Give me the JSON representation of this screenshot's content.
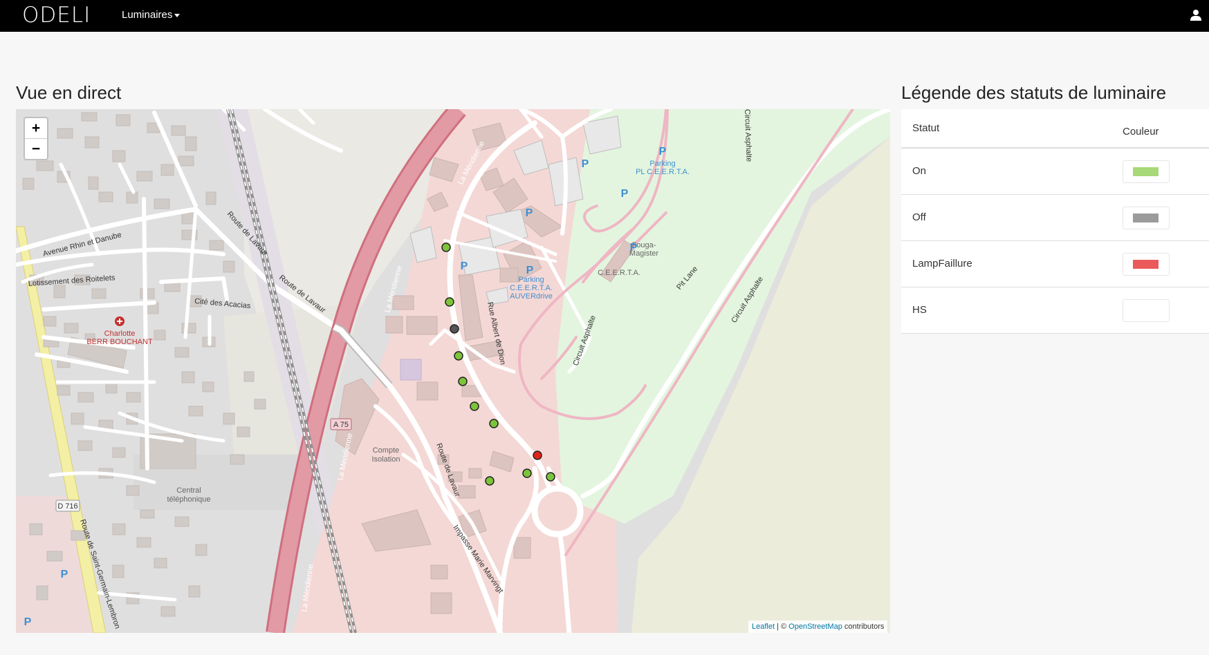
{
  "navbar": {
    "brand": "ODELI",
    "menu_label": "Luminaires"
  },
  "live_view": {
    "title": "Vue en direct"
  },
  "map": {
    "zoom_in": "+",
    "zoom_out": "−",
    "attribution_leaflet": "Leaflet",
    "attribution_sep": " | © ",
    "attribution_osm": "OpenStreetMap",
    "attribution_tail": " contributors",
    "labels": {
      "meridienne_1": "La Méridienne",
      "meridienne_2": "La Méridienne",
      "meridienne_3": "La Méridienne",
      "meridienne_4": "La Méridienne",
      "rhin_danube": "Avenue Rhin et Danube",
      "roitelets": "Lotissement des Roitelets",
      "acacias": "Cité des Acacias",
      "lavaur_1": "Route de Lavaur",
      "lavaur_2": "Route de Lavaur",
      "lavaur_3": "Route de Lavaur",
      "charlotte": "Charlotte",
      "berr": "BERR BOUCHANT",
      "albert": "Rue Albert de Dion",
      "compte_1": "Compte",
      "compte_2": "Isolation",
      "central_1": "Central",
      "central_2": "téléphonique",
      "parking_cee_1": "Parking",
      "parking_cee_2": "C.E.E.R.T.A.",
      "parking_cee_3": "AUVERdrive",
      "parking_pl_1": "Parking",
      "parking_pl_2": "PL C.E.E.R.T.A.",
      "fouga_1": "Fouga-",
      "fouga_2": "Magister",
      "ceerta": "C.E.E.R.T.A.",
      "circuit_1": "Circuit Asphalte",
      "circuit_2": "Circuit Asphalte",
      "circuit_3": "Circuit Asphalte",
      "pit_lane": "Pit Lane",
      "a75": "A 75",
      "d716": "D 716",
      "saint_germain": "Route de Saint-Germain-Lembron",
      "marie": "Impasse Marie Marvingt",
      "p": "P"
    },
    "lamps": [
      {
        "status": "On"
      },
      {
        "status": "On"
      },
      {
        "status": "Off"
      },
      {
        "status": "On"
      },
      {
        "status": "On"
      },
      {
        "status": "On"
      },
      {
        "status": "On"
      },
      {
        "status": "LampFaillure"
      },
      {
        "status": "On"
      },
      {
        "status": "On"
      },
      {
        "status": "On"
      }
    ]
  },
  "legend": {
    "title": "Légende des statuts de luminaire",
    "col_status": "Statut",
    "col_color": "Couleur",
    "rows": [
      {
        "status": "On",
        "color": "#a8d877"
      },
      {
        "status": "Off",
        "color": "#9b9b9b"
      },
      {
        "status": "LampFaillure",
        "color": "#ea5a5a"
      },
      {
        "status": "HS",
        "color": "#ffffff"
      }
    ]
  },
  "status_colors": {
    "On": "#7cc43a",
    "Off": "#555555",
    "LampFaillure": "#e0241a"
  }
}
